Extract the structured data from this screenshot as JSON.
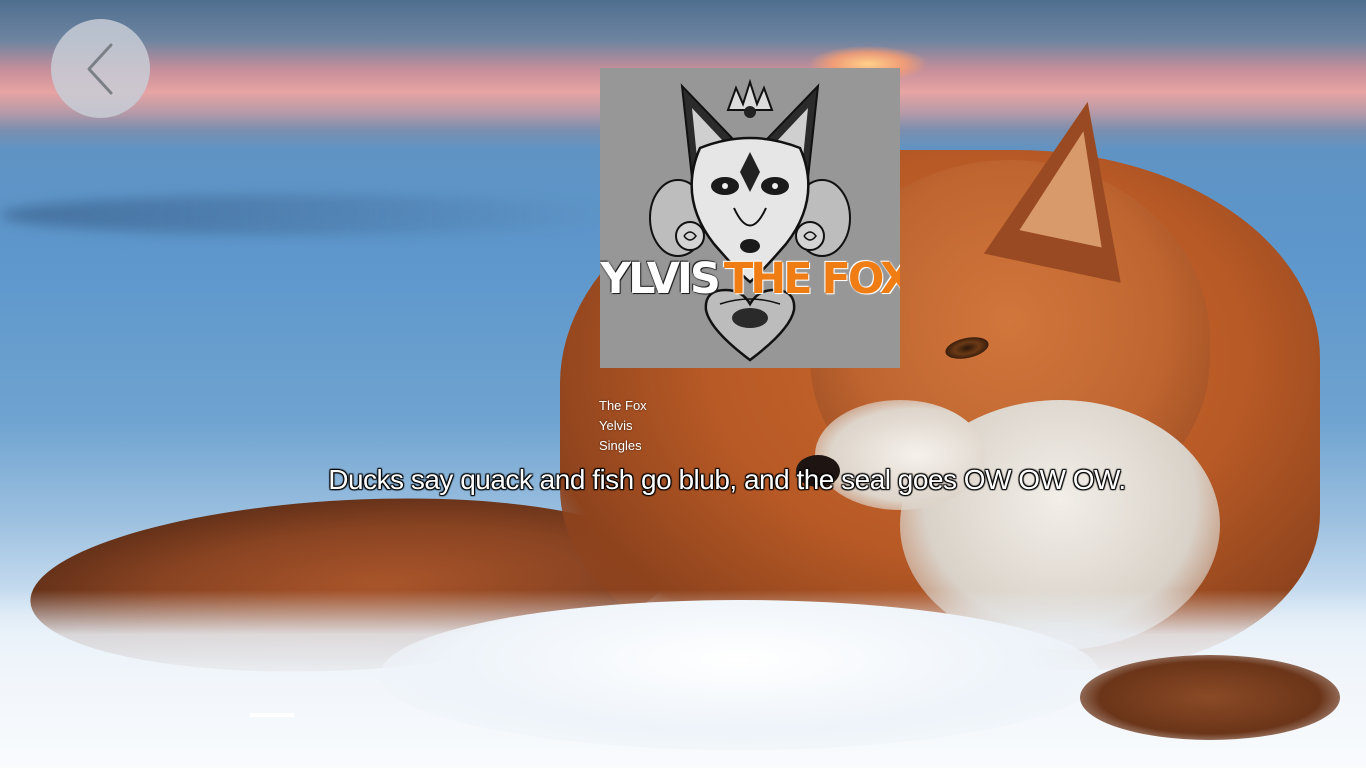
{
  "back_button": {
    "icon": "chevron-left-icon"
  },
  "album": {
    "artist_logo": "YLVIS",
    "title_logo": "THE FOX",
    "accent_color": "#f07c14",
    "background_color": "#979797"
  },
  "track": {
    "title": "The Fox",
    "artist": "Yelvis",
    "album": "Singles"
  },
  "lyrics": {
    "current_line": "Ducks say quack and fish go blub, and the seal goes OW OW OW."
  },
  "colors": {
    "back_button_bg": "#c8cdd6",
    "text": "#ffffff"
  }
}
